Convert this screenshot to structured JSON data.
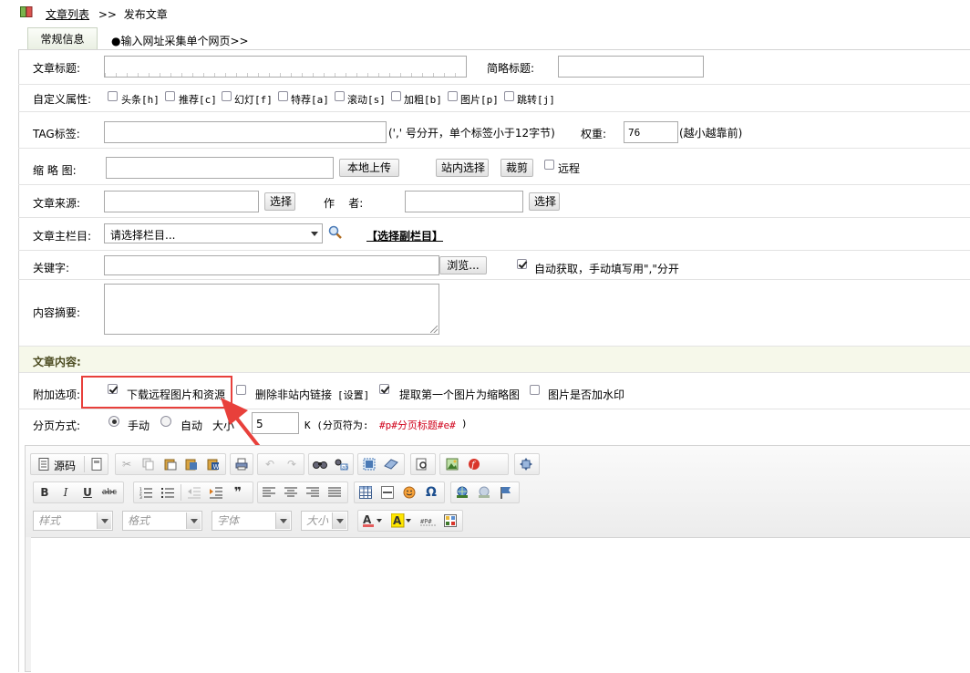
{
  "breadcrumb": {
    "list_link": "文章列表",
    "separator": ">>",
    "current": "发布文章"
  },
  "tabs": [
    {
      "label": "常规信息"
    },
    {
      "label": "●输入网址采集单个网页>>"
    }
  ],
  "form": {
    "title_label": "文章标题:",
    "short_title_label": "简略标题:",
    "custom_attr_label": "自定义属性:",
    "attrs": [
      "头条[h]",
      "推荐[c]",
      "幻灯[f]",
      "特荐[a]",
      "滚动[s]",
      "加粗[b]",
      "图片[p]",
      "跳转[j]"
    ],
    "tag_label": "TAG标签:",
    "tag_hint": "(',' 号分开，单个标签小于12字节)",
    "weight_label": "权重:",
    "weight_value": "76",
    "weight_hint": "(越小越靠前)",
    "thumb_label": "缩 略 图:",
    "upload_btn": "本地上传",
    "site_select_btn": "站内选择",
    "crop_btn": "裁剪",
    "remote_label": "远程",
    "source_label": "文章来源:",
    "source_select_btn": "选择",
    "author_label": "作    者:",
    "author_select_btn": "选择",
    "column_label": "文章主栏目:",
    "column_select": "请选择栏目...",
    "sub_column_link": "【选择副栏目】",
    "keywords_label": "关键字:",
    "browse_btn": "浏览...",
    "auto_keywords_label": "自动获取，手动填写用\",\"分开",
    "summary_label": "内容摘要:",
    "content_header": "文章内容:",
    "extra_label": "附加选项:",
    "extra_download": "下载远程图片和资源",
    "extra_remove_links": "删除非站内链接",
    "extra_settings": "[设置]",
    "extra_first_thumb": "提取第一个图片为缩略图",
    "extra_watermark": "图片是否加水印",
    "paging_label": "分页方式:",
    "paging_manual": "手动",
    "paging_auto": "自动",
    "size_label": "大小",
    "size_value": "5",
    "size_unit": "K (分页符为:",
    "page_marker": "#p#分页标题#e#",
    "size_close": ")"
  },
  "editor": {
    "source_btn": "源码",
    "style_combo": "样式",
    "format_combo": "格式",
    "font_combo": "字体",
    "size_combo": "大小"
  },
  "colors": {
    "annotation_red": "#e8403b",
    "content_header_bg": "#f6f8ea"
  }
}
